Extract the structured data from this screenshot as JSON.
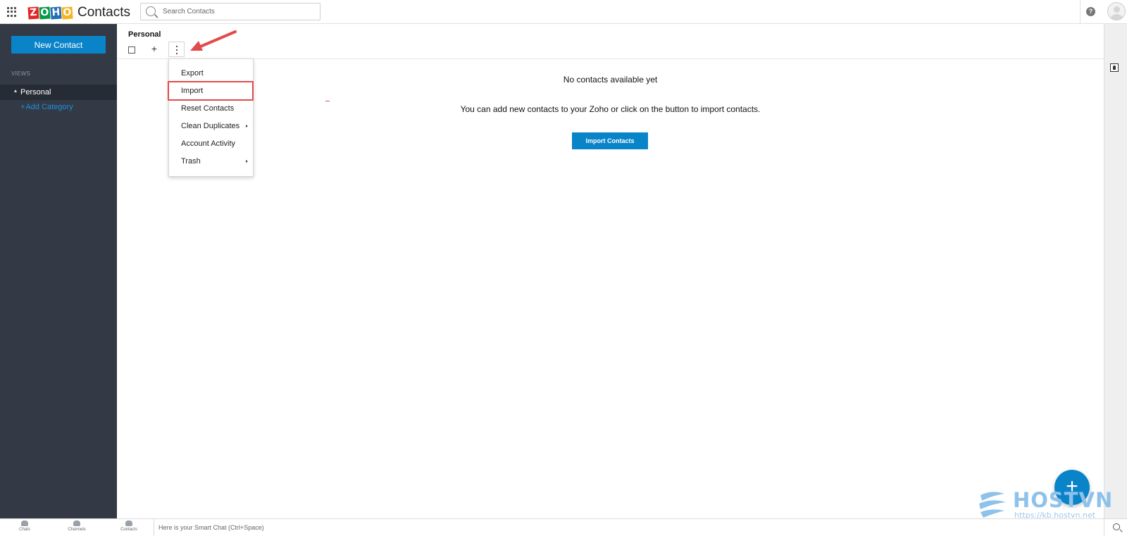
{
  "app": {
    "logo_letters": [
      "Z",
      "O",
      "H",
      "O"
    ],
    "logo_letter_colors": [
      "#e42527",
      "#089949",
      "#226db4",
      "#f9b21d"
    ],
    "title": "Contacts"
  },
  "search": {
    "placeholder": "Search Contacts"
  },
  "header_icons": [
    "apps-grid-icon",
    "help-icon",
    "avatar"
  ],
  "sidebar": {
    "new_contact_label": "New Contact",
    "views_label": "VIEWS",
    "views": [
      {
        "label": "Personal",
        "selected": true
      }
    ],
    "add_category_label": "Add Category"
  },
  "main": {
    "title": "Personal",
    "empty_title": "No contacts available yet",
    "empty_description": "You can add new contacts to your Zoho or click on the button to import contacts.",
    "import_button_label": "Import Contacts"
  },
  "dropdown": {
    "items": [
      {
        "label": "Export",
        "has_submenu": false
      },
      {
        "label": "Import",
        "has_submenu": false,
        "highlighted": true
      },
      {
        "label": "Reset Contacts",
        "has_submenu": false
      },
      {
        "label": "Clean Duplicates",
        "has_submenu": true
      },
      {
        "label": "Account Activity",
        "has_submenu": false
      },
      {
        "label": "Trash",
        "has_submenu": true
      }
    ]
  },
  "bottombar": {
    "tabs": [
      {
        "label": "Chats",
        "icon": "chat-icon"
      },
      {
        "label": "Channels",
        "icon": "channels-icon"
      },
      {
        "label": "Contacts",
        "icon": "contacts-icon"
      }
    ],
    "smart_chat_placeholder": "Here is your Smart Chat (Ctrl+Space)"
  },
  "watermark": {
    "brand": "HOSTVN",
    "url": "https://kb.hostvn.net"
  },
  "colors": {
    "accent": "#0a84c8",
    "sidebar_bg": "#333a45",
    "sidebar_selected": "#262c35",
    "annotation_red": "#e24b4b"
  }
}
